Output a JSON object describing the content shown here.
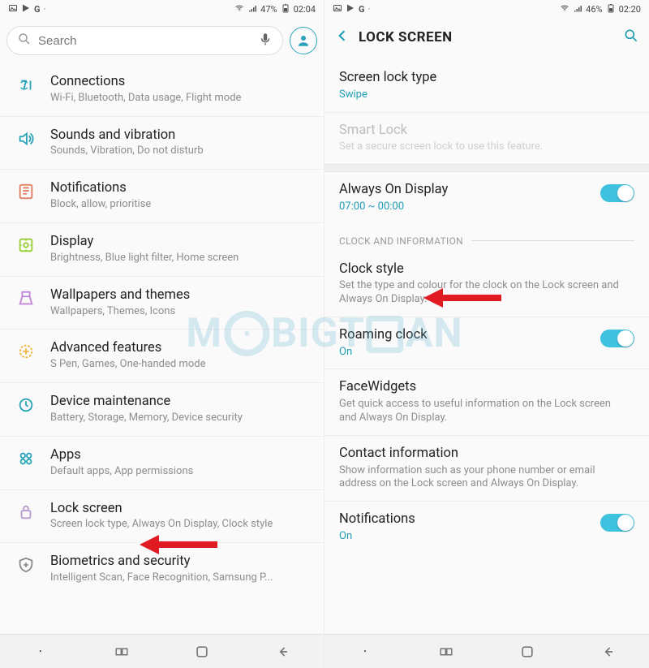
{
  "status_left": {
    "icons": [
      "gallery-icon",
      "play-store-icon",
      "g-icon",
      "dot-icon"
    ],
    "battery": "47%",
    "time": "02:04"
  },
  "status_right": {
    "icons": [
      "gallery-icon",
      "play-store-icon",
      "g-icon",
      "dot-icon"
    ],
    "battery": "46%",
    "time": "02:20"
  },
  "search": {
    "placeholder": "Search"
  },
  "profile_icon": "profile-icon",
  "mic_icon": "mic-icon",
  "search_icon": "search-icon",
  "header": {
    "title": "LOCK SCREEN"
  },
  "settings_items": [
    {
      "icon": "connections-icon",
      "title": "Connections",
      "sub": "Wi-Fi, Bluetooth, Data usage, Flight mode"
    },
    {
      "icon": "sounds-icon",
      "title": "Sounds and vibration",
      "sub": "Sounds, Vibration, Do not disturb"
    },
    {
      "icon": "notifications-icon",
      "title": "Notifications",
      "sub": "Block, allow, prioritise"
    },
    {
      "icon": "display-icon",
      "title": "Display",
      "sub": "Brightness, Blue light filter, Home screen"
    },
    {
      "icon": "wallpapers-icon",
      "title": "Wallpapers and themes",
      "sub": "Wallpapers, Themes, Icons"
    },
    {
      "icon": "advanced-icon",
      "title": "Advanced features",
      "sub": "S Pen, Games, One-handed mode"
    },
    {
      "icon": "device-maint-icon",
      "title": "Device maintenance",
      "sub": "Battery, Storage, Memory, Device security"
    },
    {
      "icon": "apps-icon",
      "title": "Apps",
      "sub": "Default apps, App permissions"
    },
    {
      "icon": "lock-screen-icon",
      "title": "Lock screen",
      "sub": "Screen lock type, Always On Display, Clock style"
    },
    {
      "icon": "biometrics-icon",
      "title": "Biometrics and security",
      "sub": "Intelligent Scan, Face Recognition, Samsung P..."
    }
  ],
  "lockscreen": {
    "screen_lock_type": {
      "title": "Screen lock type",
      "value": "Swipe"
    },
    "smart_lock": {
      "title": "Smart Lock",
      "sub": "Set a secure screen lock to use this feature."
    },
    "aod": {
      "title": "Always On Display",
      "value": "07:00 ~ 00:00",
      "on": true
    },
    "section_label": "CLOCK AND INFORMATION",
    "clock_style": {
      "title": "Clock style",
      "sub": "Set the type and colour for the clock on the Lock screen and Always On Display."
    },
    "roaming": {
      "title": "Roaming clock",
      "value": "On",
      "on": true
    },
    "facewidgets": {
      "title": "FaceWidgets",
      "sub": "Get quick access to useful information on the Lock screen and Always On Display."
    },
    "contact_info": {
      "title": "Contact information",
      "sub": "Show information such as your phone number or email address on the Lock screen and Always On Display."
    },
    "notifications": {
      "title": "Notifications",
      "value": "On",
      "on": true
    }
  },
  "watermark_parts": {
    "pre": "M",
    "mid": "BIGT",
    "suf": "AN"
  },
  "icon_colors": {
    "connections": "#2aa3b9",
    "sounds": "#2aa3b9",
    "notifications": "#e07a5f",
    "display": "#9acd32",
    "wallpapers": "#c084d8",
    "advanced": "#f2b441",
    "device_maint": "#2aa3b9",
    "apps": "#2aa3b9",
    "lock": "#b89bcf",
    "biometrics": "#8c8c8c",
    "accent": "#1f9eb3",
    "arrow": "#e11b22"
  }
}
